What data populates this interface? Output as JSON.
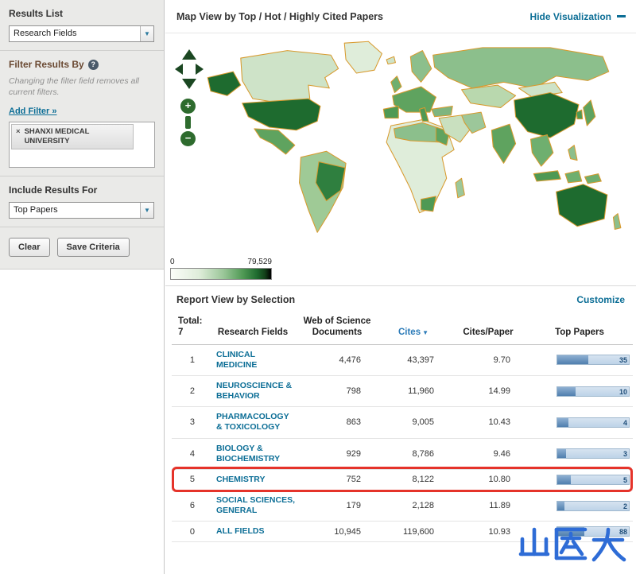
{
  "icons": {
    "chevron_down": "▼",
    "help": "?",
    "remove": "×",
    "sort_desc": "▼",
    "zoom_in": "+",
    "zoom_out": "−"
  },
  "colors": {
    "link_blue": "#0C6E96",
    "cites_header_blue": "#2C7BB8",
    "bar_fill": "#4F7FAE",
    "bar_track": "#C5D8EB",
    "map_high_green": "#1E6B2F",
    "map_low_green": "#EAF2E6",
    "map_border_orange": "#D89A2E",
    "annotation_red": "#E5332A",
    "logo_blue": "#2E6CD6"
  },
  "sidebar": {
    "results_list": {
      "label": "Results List",
      "value": "Research Fields"
    },
    "filter": {
      "label": "Filter Results By",
      "note": "Changing the filter field removes all current filters.",
      "add_filter": "Add Filter »",
      "chips": [
        {
          "label": "SHANXI MEDICAL UNIVERSITY"
        }
      ]
    },
    "include": {
      "label": "Include Results For",
      "value": "Top Papers"
    },
    "buttons": {
      "clear": "Clear",
      "save": "Save Criteria"
    }
  },
  "map": {
    "title": "Map View by  Top / Hot / Highly Cited Papers",
    "hide_visualization": "Hide Visualization",
    "legend": {
      "min": "0",
      "max": "79,529"
    }
  },
  "report": {
    "title": "Report View by  Selection",
    "customize": "Customize",
    "total_label": "Total:",
    "total_value": "7",
    "col_research_fields": "Research Fields",
    "col_docs": "Web of Science Documents",
    "col_cites": "Cites",
    "col_cites_per_paper": "Cites/Paper",
    "col_top_papers": "Top Papers",
    "rows": [
      {
        "rank": "1",
        "field": "CLINICAL MEDICINE",
        "docs": "4,476",
        "cites": "43,397",
        "cpp": "9.70",
        "top": "35",
        "bar_pct": 43
      },
      {
        "rank": "2",
        "field": "NEUROSCIENCE & BEHAVIOR",
        "docs": "798",
        "cites": "11,960",
        "cpp": "14.99",
        "top": "10",
        "bar_pct": 26
      },
      {
        "rank": "3",
        "field": "PHARMACOLOGY & TOXICOLOGY",
        "docs": "863",
        "cites": "9,005",
        "cpp": "10.43",
        "top": "4",
        "bar_pct": 15
      },
      {
        "rank": "4",
        "field": "BIOLOGY & BIOCHEMISTRY",
        "docs": "929",
        "cites": "8,786",
        "cpp": "9.46",
        "top": "3",
        "bar_pct": 12
      },
      {
        "rank": "5",
        "field": "CHEMISTRY",
        "docs": "752",
        "cites": "8,122",
        "cpp": "10.80",
        "top": "5",
        "bar_pct": 19
      },
      {
        "rank": "6",
        "field": "SOCIAL SCIENCES, GENERAL",
        "docs": "179",
        "cites": "2,128",
        "cpp": "11.89",
        "top": "2",
        "bar_pct": 10
      },
      {
        "rank": "0",
        "field": "ALL FIELDS",
        "docs": "10,945",
        "cites": "119,600",
        "cpp": "10.93",
        "top": "88",
        "bar_pct": 38
      }
    ]
  },
  "logo": {
    "text": "山医大"
  }
}
